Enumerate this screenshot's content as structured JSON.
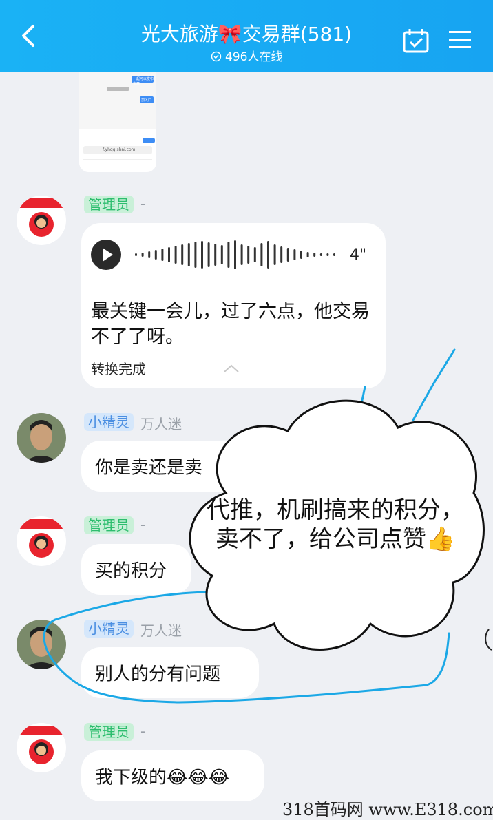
{
  "header": {
    "title": "光大旅游🎀交易群(581)",
    "online": "496人在线"
  },
  "shared_screenshot": {
    "chip_1": "一起可以发布文章",
    "chip_2": "加入口",
    "url": "f.yhqq.shai.com"
  },
  "messages": [
    {
      "tag": "管理员",
      "nick": "-",
      "type": "voice",
      "duration": "4\"",
      "transcript": "最关键一会儿，过了六点，他交易不了了呀。",
      "status": "转换完成"
    },
    {
      "tag": "小精灵",
      "nick": "万人迷",
      "text": "你是卖还是卖"
    },
    {
      "tag": "管理员",
      "nick": "-",
      "text": "买的积分"
    },
    {
      "tag": "小精灵",
      "nick": "万人迷",
      "text": "别人的分有问题"
    },
    {
      "tag": "管理员",
      "nick": "-",
      "text": "我下级的😂😂😂"
    }
  ],
  "annotation": {
    "line1": "代推，机刷搞来的积分，",
    "line2": "卖不了，给公司点赞👍"
  },
  "watermark": "318首码网 www.E318.com",
  "colors": {
    "header": "#17a4f2",
    "admin_tag": "#2dbd6e",
    "fairy_tag": "#4b8fe2",
    "scribble": "#1ba8e6"
  }
}
